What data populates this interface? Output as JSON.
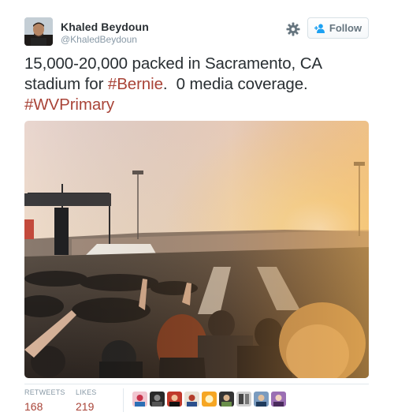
{
  "author": {
    "name": "Khaled Beydoun",
    "handle": "@KhaledBeydoun",
    "avatar_icon": "profile-photo"
  },
  "actions": {
    "settings_icon": "gear-icon",
    "follow_label": "Follow",
    "follow_icon": "add-user-icon"
  },
  "tweet": {
    "line1": "15,000-20,000 packed in Sacramento, CA",
    "line2_pre": "stadium for ",
    "hashtag1": "#Bernie",
    "line2_post": ".  0 media coverage.",
    "hashtag2": "#WVPrimary",
    "photo_description_icon": "stadium-rally-photo"
  },
  "stats": {
    "retweets_label": "RETWEETS",
    "retweets_value": "168",
    "likes_label": "LIKES",
    "likes_value": "219"
  },
  "likers_count_shown": 9,
  "colors": {
    "link": "#a94438",
    "text": "#292f33",
    "muted": "#8899a6",
    "border": "#e1e8ed"
  }
}
